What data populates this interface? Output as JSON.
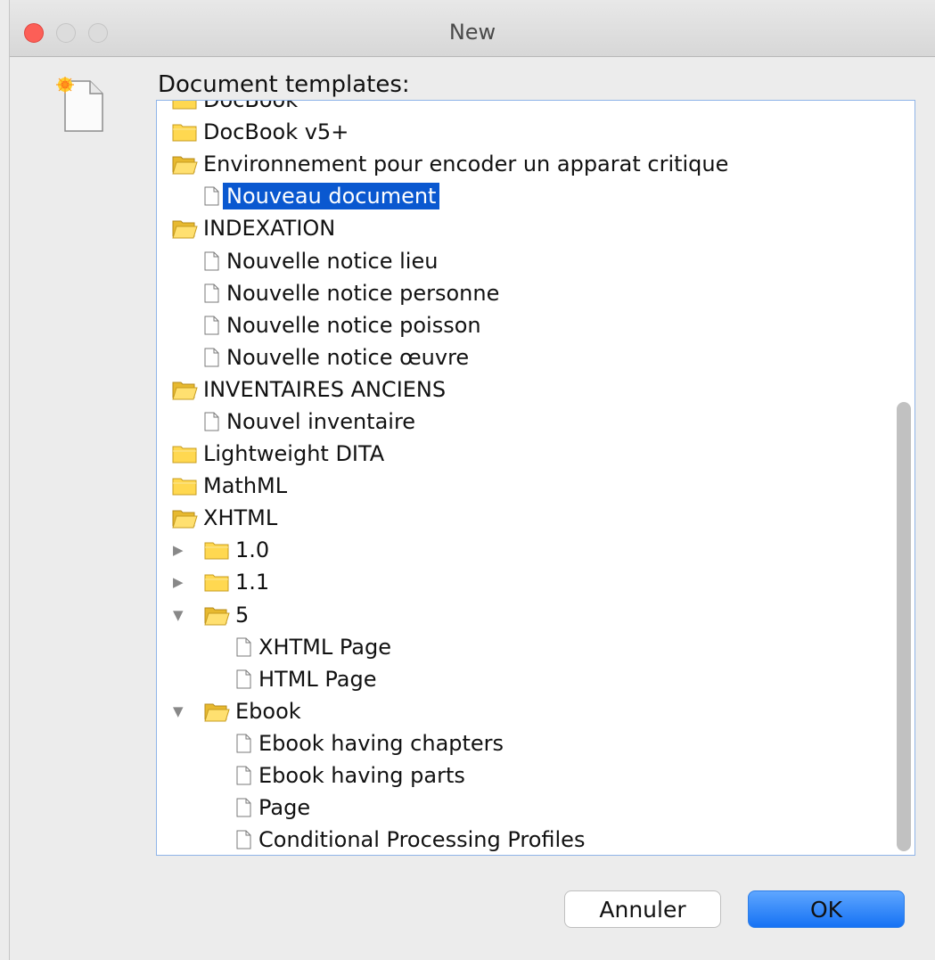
{
  "window": {
    "title": "New"
  },
  "templates_label": "Document templates:",
  "tree": [
    {
      "type": "folder",
      "label": "DocBook",
      "indent": 0,
      "partial": true
    },
    {
      "type": "folder",
      "label": "DocBook v5+",
      "indent": 0
    },
    {
      "type": "folder",
      "label": "Environnement pour encoder un apparat critique",
      "indent": 0,
      "expanded": true
    },
    {
      "type": "file",
      "label": "Nouveau document",
      "indent": 1,
      "selected": true
    },
    {
      "type": "folder",
      "label": "INDEXATION",
      "indent": 0,
      "expanded": true
    },
    {
      "type": "file",
      "label": "Nouvelle notice lieu",
      "indent": 1
    },
    {
      "type": "file",
      "label": "Nouvelle notice personne",
      "indent": 1
    },
    {
      "type": "file",
      "label": "Nouvelle notice poisson",
      "indent": 1
    },
    {
      "type": "file",
      "label": "Nouvelle notice œuvre",
      "indent": 1
    },
    {
      "type": "folder",
      "label": "INVENTAIRES ANCIENS",
      "indent": 0,
      "expanded": true
    },
    {
      "type": "file",
      "label": "Nouvel inventaire",
      "indent": 1
    },
    {
      "type": "folder",
      "label": "Lightweight DITA",
      "indent": 0
    },
    {
      "type": "folder",
      "label": "MathML",
      "indent": 0
    },
    {
      "type": "folder",
      "label": "XHTML",
      "indent": 0,
      "expanded": true
    },
    {
      "type": "folder",
      "label": "1.0",
      "indent": 1,
      "toggle": "collapsed"
    },
    {
      "type": "folder",
      "label": "1.1",
      "indent": 1,
      "toggle": "collapsed"
    },
    {
      "type": "folder",
      "label": "5",
      "indent": 1,
      "toggle": "expanded",
      "expanded": true
    },
    {
      "type": "file",
      "label": "XHTML Page",
      "indent": 2
    },
    {
      "type": "file",
      "label": "HTML Page",
      "indent": 2
    },
    {
      "type": "folder",
      "label": "Ebook",
      "indent": 1,
      "toggle": "expanded",
      "expanded": true
    },
    {
      "type": "file",
      "label": "Ebook having chapters",
      "indent": 2
    },
    {
      "type": "file",
      "label": "Ebook having parts",
      "indent": 2
    },
    {
      "type": "file",
      "label": "Page",
      "indent": 2
    },
    {
      "type": "file",
      "label": "Conditional Processing Profiles",
      "indent": 2
    }
  ],
  "buttons": {
    "cancel": "Annuler",
    "ok": "OK"
  },
  "colors": {
    "selection": "#0a58d0",
    "ok_button": "#1672f4",
    "tree_border": "#8fb4e8"
  }
}
